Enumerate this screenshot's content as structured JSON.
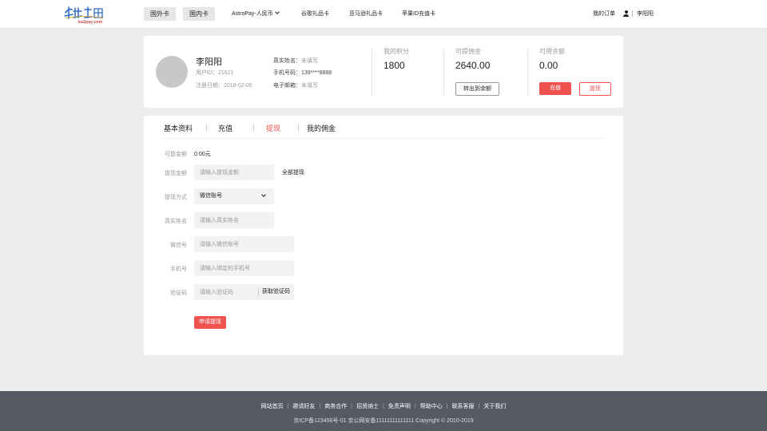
{
  "header": {
    "logo_sub": "ka2pay.com",
    "nav_buttons": [
      "国外卡",
      "国内卡"
    ],
    "nav_links": [
      "AstroPay-人民币",
      "谷歌礼品卡",
      "亚马逊礼品卡",
      "苹果ID充值卡"
    ],
    "my_orders": "我的订单",
    "username": "李阳阳"
  },
  "profile": {
    "name": "李阳阳",
    "user_id_label": "用户ID：",
    "user_id": "21621",
    "reg_date_label": "注册日期：",
    "reg_date": "2018-02-06",
    "real_name_label": "真实姓名：",
    "real_name": "未填写",
    "phone_label": "手机号码：",
    "phone": "139****8888",
    "email_label": "电子邮箱：",
    "email": "未填写",
    "stats": [
      {
        "label": "我的积分",
        "value": "1800"
      },
      {
        "label": "可提佣金",
        "value": "2640.00"
      },
      {
        "label": "可用余额",
        "value": "0.00"
      }
    ],
    "transfer_button": "转出到余额",
    "recharge_button": "充值",
    "withdraw_button": "提现"
  },
  "tabs": [
    "基本资料",
    "充值",
    "提现",
    "我的佣金"
  ],
  "active_tab": 2,
  "form": {
    "available_label": "可提金额",
    "available_value": "0.00元",
    "amount_label": "提现金额",
    "amount_placeholder": "请输入提现金额",
    "withdraw_all": "全部提现",
    "method_label": "提现方式",
    "method_value": "微信账号",
    "realname_label": "真实姓名",
    "realname_placeholder": "请输入真实姓名",
    "wechat_label": "微信号",
    "wechat_placeholder": "请输入微信账号",
    "phone_label": "手机号",
    "phone_placeholder": "请输入绑定的手机号",
    "code_label": "验证码",
    "code_placeholder": "请输入验证码",
    "get_code": "获取验证码",
    "submit": "申请提现"
  },
  "footer": {
    "links": [
      "网站首页",
      "邀请好友",
      "商务合作",
      "招贤纳士",
      "免责声明",
      "帮助中心",
      "联系客服",
      "关于我们"
    ],
    "copyright": "京ICP备123456号-01  京公网安备11111111111111  Copyright  ©  2010-2019"
  },
  "colors": {
    "accent": "#ef5350",
    "footer_bg": "#575a65",
    "page_bg": "#ededed"
  }
}
